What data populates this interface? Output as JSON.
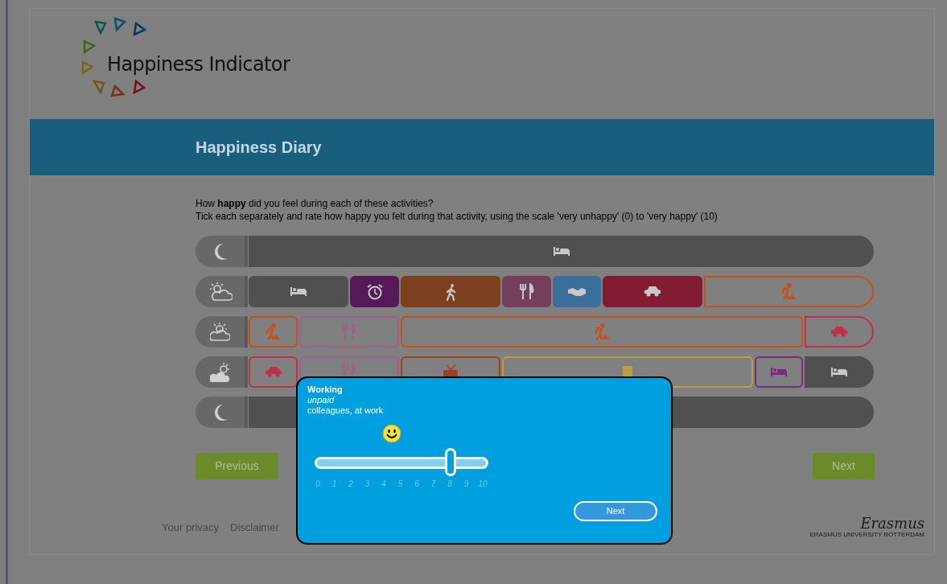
{
  "header": {
    "logo_text": "Happiness Indicator",
    "title": "Happiness Diary"
  },
  "instructions": [
    "How **happy** did you feel during each of these activities?",
    "Tick each separately and rate how happy you felt during that activity, using the scale 'very unhappy' (0) to 'very happy' (10)"
  ],
  "timeline": [
    {
      "kind": "night",
      "segments": [
        {
          "kind": "sleep",
          "filled": true,
          "color": "#505050"
        }
      ]
    },
    {
      "kind": "morning",
      "segments": [
        {
          "kind": "sleep",
          "filled": true,
          "color": "#505050"
        },
        {
          "kind": "alarm",
          "filled": true,
          "color": "#561a5a"
        },
        {
          "kind": "walking",
          "filled": true,
          "color": "#7d401e"
        },
        {
          "kind": "eating",
          "filled": true,
          "color": "#753f5c"
        },
        {
          "kind": "meeting",
          "filled": true,
          "color": "#3b6e9a"
        },
        {
          "kind": "driving",
          "filled": true,
          "color": "#821c32"
        },
        {
          "kind": "working",
          "filled": false,
          "color": "#c8501a"
        }
      ]
    },
    {
      "kind": "afternoon",
      "segments": [
        {
          "kind": "working",
          "filled": false,
          "color": "#c8501a"
        },
        {
          "kind": "eating",
          "filled": false,
          "color": "#a0608a"
        },
        {
          "kind": "working",
          "filled": false,
          "color": "#c8501a"
        },
        {
          "kind": "driving",
          "filled": false,
          "color": "#c0304a"
        }
      ]
    },
    {
      "kind": "evening",
      "segments": [
        {
          "kind": "driving",
          "filled": false,
          "color": "#c0304a"
        },
        {
          "kind": "eating",
          "filled": false,
          "color": "#a0608a"
        },
        {
          "kind": "tv",
          "filled": false,
          "color": "#a04020"
        },
        {
          "kind": "reading",
          "filled": false,
          "color": "#b8a040"
        },
        {
          "kind": "sleep",
          "filled": false,
          "color": "#7a2a7e"
        },
        {
          "kind": "sleep",
          "filled": true,
          "color": "#505050"
        }
      ]
    },
    {
      "kind": "night",
      "segments": [
        {
          "filled": true,
          "color": "#505050"
        }
      ]
    }
  ],
  "navigation": {
    "previous": "Previous",
    "next": "Next"
  },
  "dialog": {
    "title": "Working",
    "subtitle": "unpaid",
    "detail": "colleagues, at work",
    "rating": {
      "level": 0.8,
      "ticks": [
        "0",
        "1",
        "2",
        "3",
        "4",
        "5",
        "6",
        "7",
        "8",
        "9",
        "10"
      ]
    },
    "next": "Next"
  },
  "footer": {
    "links": [
      "Your privacy",
      "Disclaimer"
    ],
    "logo_script": "Erasmus",
    "logo_caption": "ERASMUS UNIVERSITY ROTTERDAM"
  }
}
